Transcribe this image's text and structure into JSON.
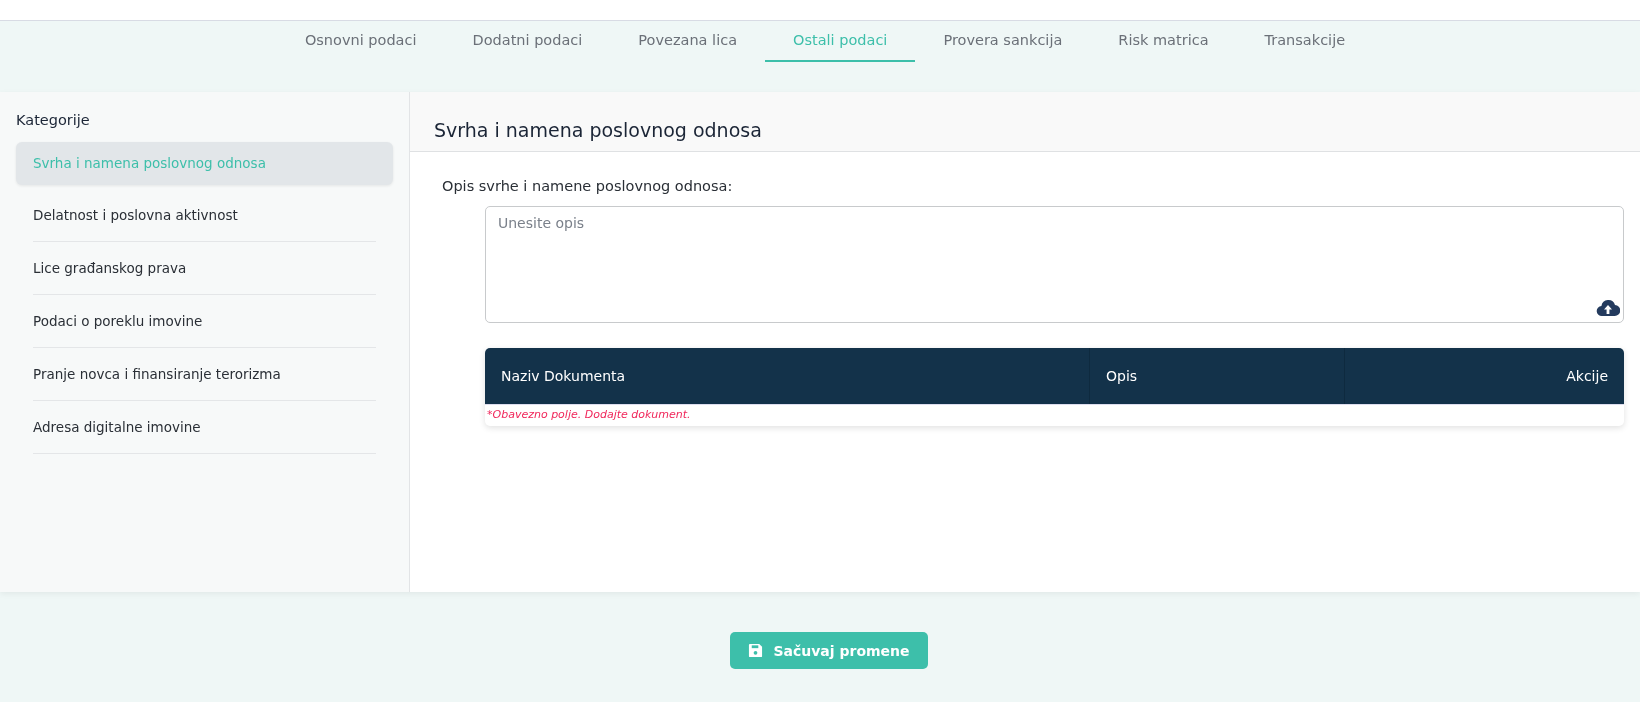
{
  "tabs": [
    {
      "label": "Osnovni podaci",
      "selected": false
    },
    {
      "label": "Dodatni podaci",
      "selected": false
    },
    {
      "label": "Povezana lica",
      "selected": false
    },
    {
      "label": "Ostali podaci",
      "selected": true
    },
    {
      "label": "Provera sankcija",
      "selected": false
    },
    {
      "label": "Risk matrica",
      "selected": false
    },
    {
      "label": "Transakcije",
      "selected": false
    }
  ],
  "sidebar": {
    "title": "Kategorije",
    "items": [
      {
        "label": "Svrha i namena poslovnog odnosa",
        "selected": true
      },
      {
        "label": "Delatnost i poslovna aktivnost",
        "selected": false
      },
      {
        "label": "Lice građanskog prava",
        "selected": false
      },
      {
        "label": "Podaci o poreklu imovine",
        "selected": false
      },
      {
        "label": "Pranje novca i finansiranje terorizma",
        "selected": false
      },
      {
        "label": "Adresa digitalne imovine",
        "selected": false
      }
    ]
  },
  "content": {
    "title": "Svrha i namena poslovnog odnosa",
    "field_label": "Opis svrhe i namene poslovnog odnosa:",
    "placeholder": "Unesite opis",
    "table": {
      "columns": [
        "Naziv Dokumenta",
        "Opis",
        "Akcije"
      ],
      "error": "*Obavezno polje. Dodajte dokument."
    }
  },
  "save_button": "Sačuvaj promene"
}
